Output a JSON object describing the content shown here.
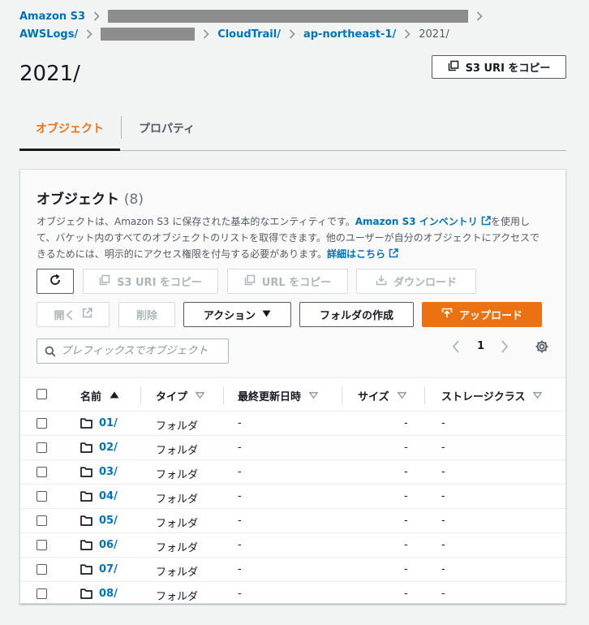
{
  "breadcrumb": {
    "row1": [
      "Amazon S3"
    ],
    "row2": [
      "AWSLogs/",
      "CloudTrail/",
      "ap-northeast-1/",
      "2021/"
    ]
  },
  "page": {
    "title": "2021/",
    "copy_uri_label": "S3 URI をコピー"
  },
  "tabs": [
    {
      "label": "オブジェクト",
      "active": true
    },
    {
      "label": "プロパティ",
      "active": false
    }
  ],
  "objects": {
    "title": "オブジェクト",
    "count": "(8)",
    "desc_1": "オブジェクトは、Amazon S3 に保存された基本的なエンティティです。",
    "desc_link_1": "Amazon S3 インベントリ",
    "desc_2": "を使用して、バケット内のすべてのオブジェクトのリストを取得できます。他のユーザーが自分のオブジェクトにアクセスできるためには、明示的にアクセス権限を付与する必要があります。",
    "desc_link_2": "詳細はこちら",
    "toolbar": {
      "copy_s3_uri": "S3 URI をコピー",
      "copy_url": "URL をコピー",
      "download": "ダウンロード",
      "open": "開く",
      "delete": "削除",
      "actions": "アクション",
      "create_folder": "フォルダの作成",
      "upload": "アップロード"
    },
    "search_placeholder": "プレフィックスでオブジェクト",
    "page_number": "1",
    "columns": {
      "name": "名前",
      "type": "タイプ",
      "modified": "最終更新日時",
      "size": "サイズ",
      "storage_class": "ストレージクラス"
    },
    "rows": [
      {
        "name": "01/",
        "type": "フォルダ",
        "modified": "-",
        "size": "-",
        "storage_class": "-"
      },
      {
        "name": "02/",
        "type": "フォルダ",
        "modified": "-",
        "size": "-",
        "storage_class": "-"
      },
      {
        "name": "03/",
        "type": "フォルダ",
        "modified": "-",
        "size": "-",
        "storage_class": "-"
      },
      {
        "name": "04/",
        "type": "フォルダ",
        "modified": "-",
        "size": "-",
        "storage_class": "-"
      },
      {
        "name": "05/",
        "type": "フォルダ",
        "modified": "-",
        "size": "-",
        "storage_class": "-"
      },
      {
        "name": "06/",
        "type": "フォルダ",
        "modified": "-",
        "size": "-",
        "storage_class": "-"
      },
      {
        "name": "07/",
        "type": "フォルダ",
        "modified": "-",
        "size": "-",
        "storage_class": "-"
      },
      {
        "name": "08/",
        "type": "フォルダ",
        "modified": "-",
        "size": "-",
        "storage_class": "-"
      }
    ]
  },
  "colors": {
    "link": "#0073bb",
    "accent": "#ec7211",
    "text": "#16191f",
    "muted": "#545b64",
    "background": "#f2f3f3"
  }
}
